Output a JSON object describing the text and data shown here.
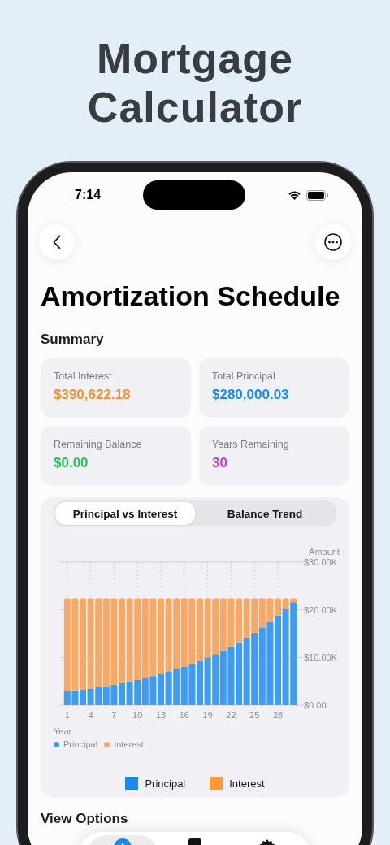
{
  "headline": "Mortgage Calculator",
  "status_bar": {
    "time": "7:14"
  },
  "title": "Amortization Schedule",
  "summary": {
    "heading": "Summary",
    "cards": [
      {
        "label": "Total Interest",
        "value": "$390,622.18",
        "color": "#f5902e"
      },
      {
        "label": "Total Principal",
        "value": "$280,000.03",
        "color": "#1a8af0"
      },
      {
        "label": "Remaining Balance",
        "value": "$0.00",
        "color": "#30c254"
      },
      {
        "label": "Years Remaining",
        "value": "30",
        "color": "#c83ad6"
      }
    ]
  },
  "chart_card": {
    "tabs": [
      {
        "label": "Principal vs Interest",
        "selected": true
      },
      {
        "label": "Balance Trend",
        "selected": false
      }
    ],
    "chart_data": {
      "type": "bar",
      "stacked": true,
      "xlabel": "Year",
      "ylabel": "Amount",
      "x": [
        1,
        2,
        3,
        4,
        5,
        6,
        7,
        8,
        9,
        10,
        11,
        12,
        13,
        14,
        15,
        16,
        17,
        18,
        19,
        20,
        21,
        22,
        23,
        24,
        25,
        26,
        27,
        28,
        29,
        30
      ],
      "grid": true,
      "legend": true,
      "xlim": [
        0.5,
        30.5
      ],
      "series": [
        {
          "name": "Principal",
          "color": "#3d9cf5",
          "values": [
            2900,
            3100,
            3300,
            3500,
            3800,
            4000,
            4300,
            4600,
            5000,
            5300,
            5700,
            6100,
            6600,
            7100,
            7600,
            8100,
            8700,
            9300,
            10000,
            10700,
            11500,
            12300,
            13200,
            14200,
            15200,
            16300,
            17500,
            18800,
            20100,
            21600
          ]
        },
        {
          "name": "Interest",
          "color": "#f8a862",
          "values": [
            19500,
            19300,
            19100,
            18900,
            18600,
            18400,
            18100,
            17800,
            17400,
            17100,
            16700,
            16300,
            15800,
            15300,
            14800,
            14300,
            13700,
            13100,
            12400,
            11700,
            10900,
            10100,
            9200,
            8200,
            7200,
            6100,
            4900,
            3600,
            2300,
            800
          ]
        }
      ],
      "ylim": [
        0,
        30000
      ],
      "yticks": [
        {
          "value": 0,
          "label": "$0.00"
        },
        {
          "value": 10000,
          "label": "$10.00K"
        },
        {
          "value": 20000,
          "label": "$20.00K"
        },
        {
          "value": 30000,
          "label": "$30.00K"
        }
      ],
      "xticks": [
        1,
        4,
        7,
        10,
        13,
        16,
        19,
        22,
        25,
        28
      ]
    },
    "legend": [
      {
        "label": "Principal",
        "color": "#1a8af0"
      },
      {
        "label": "Interest",
        "color": "#fd9a33"
      }
    ]
  },
  "view_options": {
    "heading": "View Options"
  },
  "tab_bar": [
    {
      "kind": "plus",
      "selected": true
    },
    {
      "kind": "device",
      "selected": false
    },
    {
      "kind": "gear",
      "selected": false
    }
  ]
}
